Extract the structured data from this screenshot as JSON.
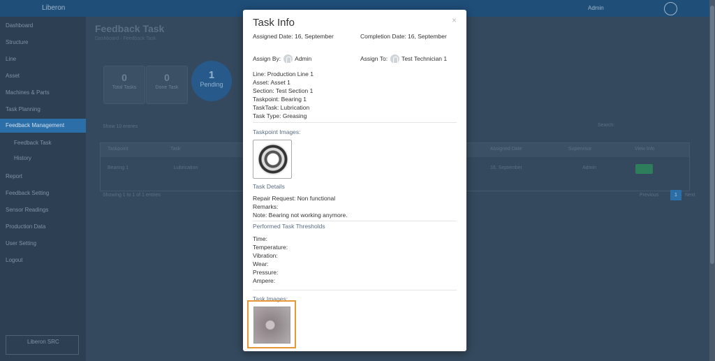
{
  "background": {
    "app_brand": "Liberon",
    "page_title": "Feedback Task",
    "breadcrumb": "Dashboard › Feedback Task",
    "user_label": "Admin",
    "stats": [
      {
        "value": "0",
        "label": "Total Tasks"
      },
      {
        "value": "0",
        "label": "Done Task"
      },
      {
        "value": "1",
        "label": "Pending"
      }
    ],
    "sidebar": [
      "Dashboard",
      "Structure",
      "Line",
      "Asset",
      "Machines & Parts",
      "Task Planning",
      "Feedback Management",
      "Feedback Task",
      "History",
      "Report",
      "Feedback Setting",
      "Sensor Readings",
      "Production Data",
      "User Setting",
      "Logout"
    ],
    "active_sidebar_index": 6,
    "table_headers": [
      "Taskpoint",
      "Task",
      "Task Type",
      "Assigned Date",
      "Supervisor",
      "View Info"
    ],
    "table_row": {
      "taskpoint": "Bearing 1",
      "task": "Lubrication",
      "assigned_date": "16, September",
      "supervisor": "Admin"
    },
    "table_footer": "Showing 1 to 1 of 1 entries",
    "pagination": [
      "Previous",
      "1",
      "Next"
    ],
    "show_entries": "Show 10 entries",
    "search_label": "Search:",
    "footer_logo": "Liberon SRC"
  },
  "modal": {
    "title": "Task Info",
    "close_symbol": "×",
    "assigned_date_label": "Assigned Date:",
    "assigned_date": "16, September",
    "completion_date_label": "Completion Date:",
    "completion_date": "16, September",
    "assign_by_label": "Assign By:",
    "assign_by": "Admin",
    "assign_to_label": "Assign To:",
    "assign_to": "Test Technician 1",
    "line": "Line: Production Line 1",
    "asset": "Asset: Asset 1",
    "section": "Section: Test Section 1",
    "taskpoint": "Taskpoint: Bearing 1",
    "tasktask": "TaskTask: Lubrication",
    "task_type": "Task Type: Greasing",
    "taskpoint_images_label": "Taskpoint Images:",
    "task_details_label": "Task Details",
    "repair_request": "Repair Request: Non functional",
    "remarks": "Remarks:",
    "note": "Note: Bearing not working anymore.",
    "thresholds_label": "Performed Task Thresholds",
    "thresholds": [
      "Time:",
      "Temperature:",
      "Vibration:",
      "Wear:",
      "Pressure:",
      "Ampere:"
    ],
    "task_images_label": "Task Images:"
  },
  "colors": {
    "highlight": "#e8963a",
    "topbar": "#1f4e79",
    "accent": "#2b6ea8"
  }
}
